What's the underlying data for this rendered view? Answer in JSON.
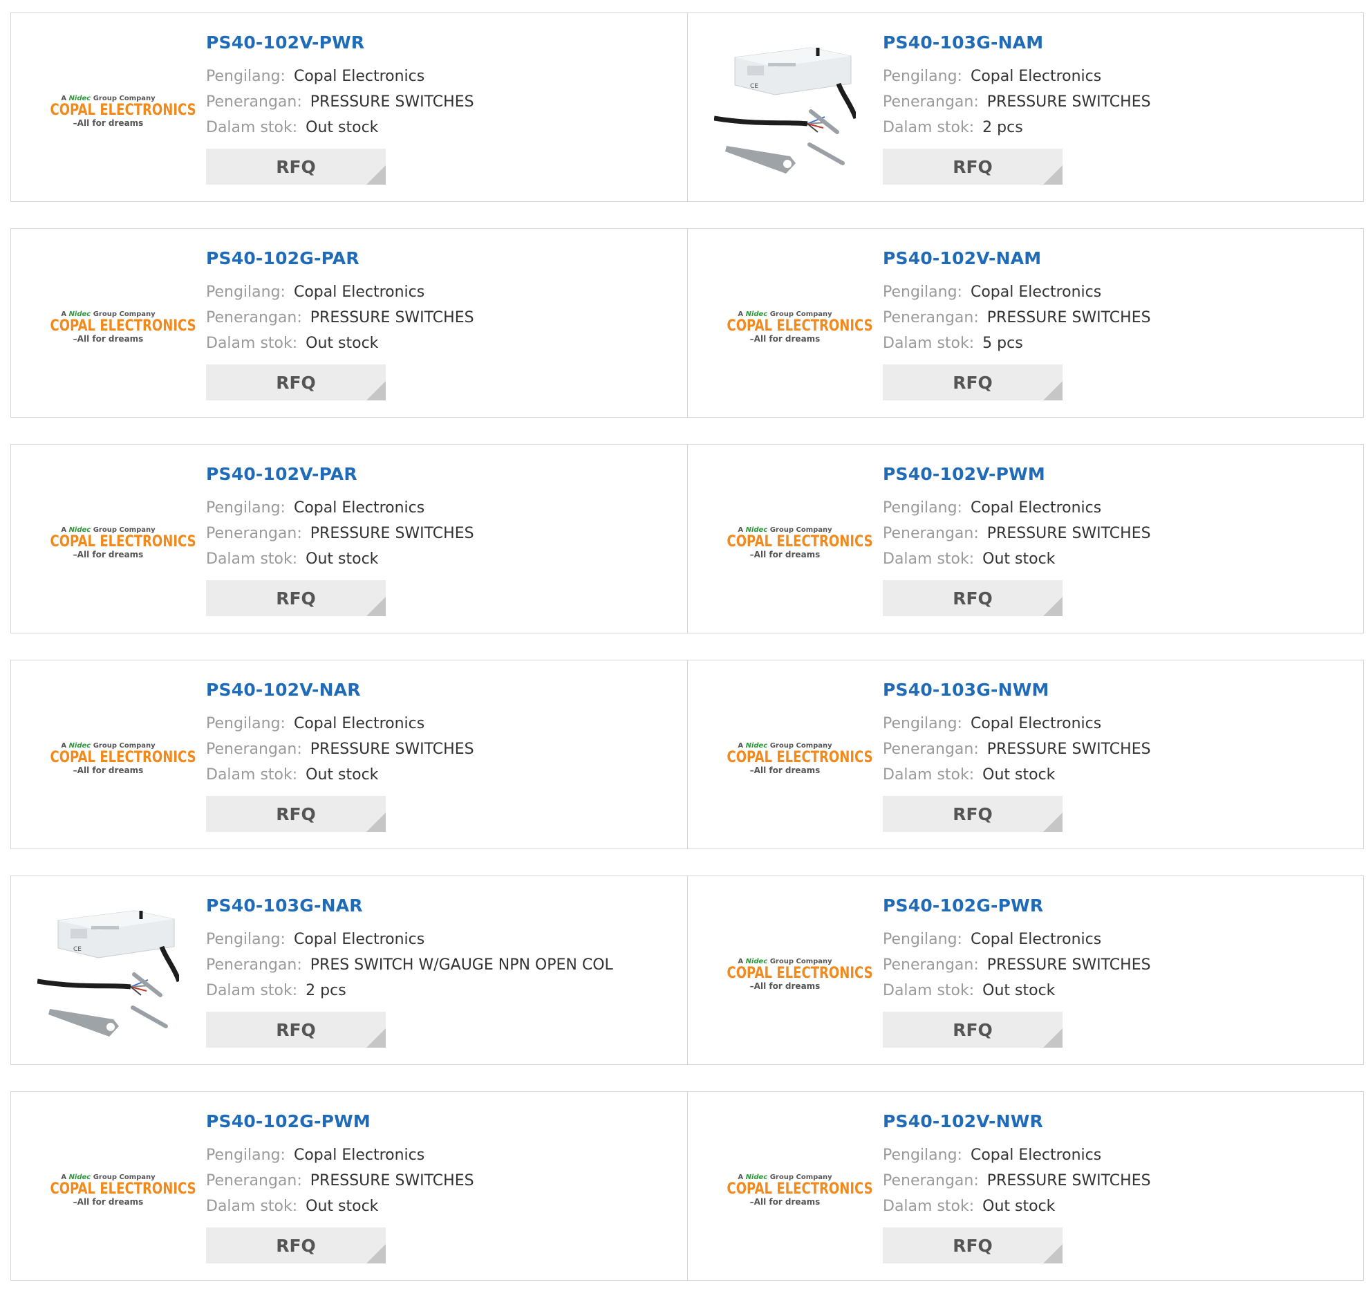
{
  "labels": {
    "manufacturer": "Pengilang:",
    "description": "Penerangan:",
    "stock": "Dalam stok:",
    "rfq": "RFQ"
  },
  "logo": {
    "prefix": "A",
    "brand": "Nidec",
    "group": "Group Company",
    "name": "COPAL ELECTRONICS",
    "tagline": "–All for dreams"
  },
  "products": [
    {
      "part": "PS40-102V-PWR",
      "manufacturer": "Copal Electronics",
      "description": "PRESSURE SWITCHES",
      "stock": "Out stock",
      "image": "logo"
    },
    {
      "part": "PS40-103G-NAM",
      "manufacturer": "Copal Electronics",
      "description": "PRESSURE SWITCHES",
      "stock": "2 pcs",
      "image": "photo"
    },
    {
      "part": "PS40-102G-PAR",
      "manufacturer": "Copal Electronics",
      "description": "PRESSURE SWITCHES",
      "stock": "Out stock",
      "image": "logo"
    },
    {
      "part": "PS40-102V-NAM",
      "manufacturer": "Copal Electronics",
      "description": "PRESSURE SWITCHES",
      "stock": "5 pcs",
      "image": "logo"
    },
    {
      "part": "PS40-102V-PAR",
      "manufacturer": "Copal Electronics",
      "description": "PRESSURE SWITCHES",
      "stock": "Out stock",
      "image": "logo"
    },
    {
      "part": "PS40-102V-PWM",
      "manufacturer": "Copal Electronics",
      "description": "PRESSURE SWITCHES",
      "stock": "Out stock",
      "image": "logo"
    },
    {
      "part": "PS40-102V-NAR",
      "manufacturer": "Copal Electronics",
      "description": "PRESSURE SWITCHES",
      "stock": "Out stock",
      "image": "logo"
    },
    {
      "part": "PS40-103G-NWM",
      "manufacturer": "Copal Electronics",
      "description": "PRESSURE SWITCHES",
      "stock": "Out stock",
      "image": "logo"
    },
    {
      "part": "PS40-103G-NAR",
      "manufacturer": "Copal Electronics",
      "description": "PRES SWITCH W/GAUGE NPN OPEN COL",
      "stock": "2 pcs",
      "image": "photo"
    },
    {
      "part": "PS40-102G-PWR",
      "manufacturer": "Copal Electronics",
      "description": "PRESSURE SWITCHES",
      "stock": "Out stock",
      "image": "logo"
    },
    {
      "part": "PS40-102G-PWM",
      "manufacturer": "Copal Electronics",
      "description": "PRESSURE SWITCHES",
      "stock": "Out stock",
      "image": "logo"
    },
    {
      "part": "PS40-102V-NWR",
      "manufacturer": "Copal Electronics",
      "description": "PRESSURE SWITCHES",
      "stock": "Out stock",
      "image": "logo"
    }
  ]
}
